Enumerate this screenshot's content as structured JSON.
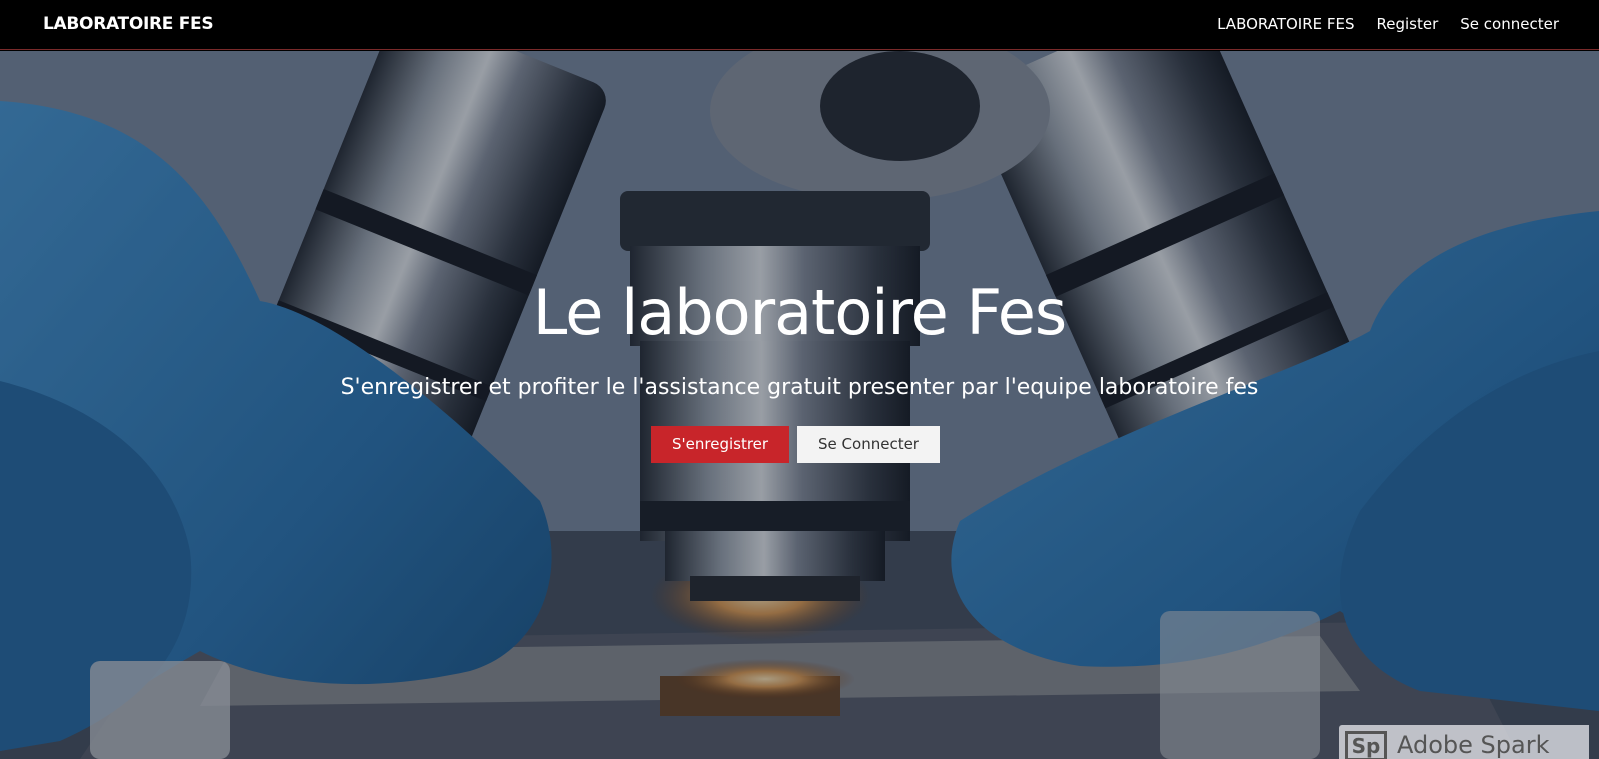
{
  "navbar": {
    "brand": "LABORATOIRE FES",
    "links": [
      "LABORATOIRE FES",
      "Register",
      "Se connecter"
    ]
  },
  "hero": {
    "title": "Le laboratoire Fes",
    "subtitle": "S'enregistrer et profiter le l'assistance gratuit presenter par l'equipe laboratoire fes",
    "primary_button": "S'enregistrer",
    "secondary_button": "Se Connecter",
    "background_image": "microscope-lab-photo"
  },
  "watermark": {
    "logo": "Sp",
    "text": "Adobe Spark"
  },
  "colors": {
    "navbar_bg": "#000000",
    "primary_button": "#c8252a",
    "secondary_button": "#f3f3f3",
    "glove_blue": "#3a86c4"
  }
}
